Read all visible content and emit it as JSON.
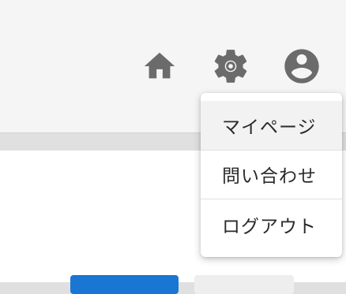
{
  "header": {
    "icons": {
      "home": "home-icon",
      "settings": "gear-icon",
      "account": "account-circle-icon"
    },
    "icon_color": "#6b6b6b"
  },
  "user_menu": {
    "items": [
      {
        "label": "マイページ",
        "highlighted": true
      },
      {
        "label": "問い合わせ",
        "highlighted": false
      },
      {
        "label": "ログアウト",
        "highlighted": false
      }
    ]
  },
  "colors": {
    "primary": "#1976d2",
    "secondary": "#eeeeee",
    "header_bg": "#f5f5f5",
    "menu_highlight": "#f2f2f2"
  }
}
